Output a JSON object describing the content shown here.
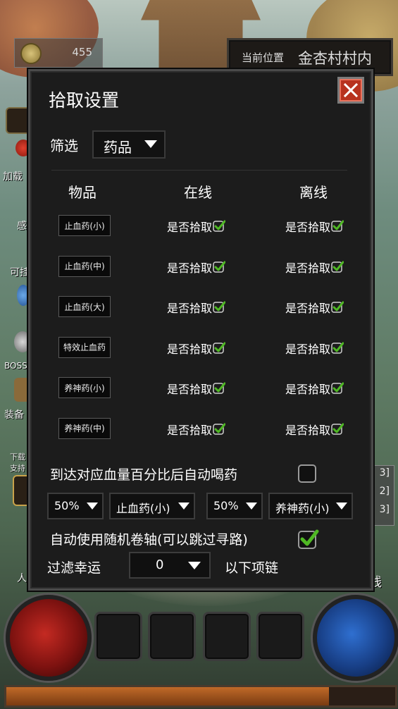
{
  "hud": {
    "gold": "455",
    "location_label": "当前位置",
    "location_value": "金杏村村内",
    "side_labels": [
      "加载",
      "感",
      "可挂",
      "BOSS",
      "装备",
      "下载",
      "支持",
      "人"
    ],
    "right_list": [
      "3]",
      "2]",
      "3]"
    ],
    "right_label": "线",
    "xp_fraction": 0.83
  },
  "dialog": {
    "title": "拾取设置",
    "filter_label": "筛选",
    "filter_value": "药品",
    "columns": [
      "物品",
      "在线",
      "离线"
    ],
    "rows": [
      {
        "item": "止血药(小)",
        "online": "是否拾取",
        "offline": "是否拾取",
        "online_checked": true,
        "offline_checked": true
      },
      {
        "item": "止血药(中)",
        "online": "是否拾取",
        "offline": "是否拾取",
        "online_checked": true,
        "offline_checked": true
      },
      {
        "item": "止血药(大)",
        "online": "是否拾取",
        "offline": "是否拾取",
        "online_checked": true,
        "offline_checked": true
      },
      {
        "item": "特效止血药",
        "online": "是否拾取",
        "offline": "是否拾取",
        "online_checked": true,
        "offline_checked": true
      },
      {
        "item": "养神药(小)",
        "online": "是否拾取",
        "offline": "是否拾取",
        "online_checked": true,
        "offline_checked": true
      },
      {
        "item": "养神药(中)",
        "online": "是否拾取",
        "offline": "是否拾取",
        "online_checked": true,
        "offline_checked": true
      }
    ],
    "auto_drink_label": "到达对应血量百分比后自动喝药",
    "auto_drink_checked": false,
    "hp_percent": "50%",
    "hp_potion": "止血药(小)",
    "mp_percent": "50%",
    "mp_potion": "养神药(小)",
    "auto_scroll_label": "自动使用随机卷轴(可以跳过寻路)",
    "auto_scroll_checked": true,
    "luck_label": "过滤幸运",
    "luck_value": "0",
    "necklace_label": "以下项链",
    "colors": {
      "check": "#4fb824",
      "close": "#b8321f",
      "panel": "#1c1c1c"
    }
  }
}
